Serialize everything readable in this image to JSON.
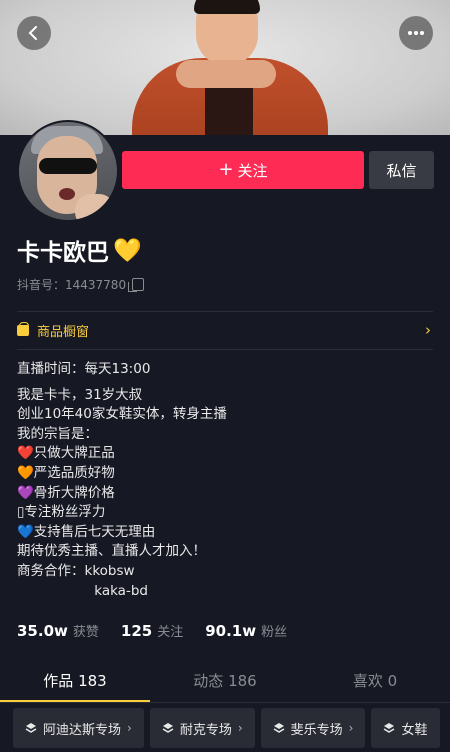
{
  "header": {
    "back_icon": "chevron-left-icon",
    "more_icon": "more-dots-icon"
  },
  "profile": {
    "follow_label": "关注",
    "message_label": "私信",
    "nickname": "卡卡欧巴",
    "nickname_emoji": "💛",
    "douyin_id": "抖音号：14437780"
  },
  "shop": {
    "label": "商品橱窗",
    "arrow": "›"
  },
  "bio": {
    "lines": [
      "直播时间：每天13:00",
      "",
      "我是卡卡，31岁大叔",
      "创业10年40家女鞋实体，转身主播",
      "我的宗旨是：",
      "❤️只做大牌正品",
      "🧡严选品质好物",
      "💜骨折大牌价格",
      "▯专注粉丝浮力",
      "💙支持售后七天无理由",
      "期待优秀主播、直播人才加入！",
      "商务合作：kkobsw",
      "                  kaka-bd"
    ]
  },
  "stats": [
    {
      "value": "35.0w",
      "label": "获赞"
    },
    {
      "value": "125",
      "label": "关注"
    },
    {
      "value": "90.1w",
      "label": "粉丝"
    }
  ],
  "tabs": [
    {
      "label": "作品 183",
      "active": true
    },
    {
      "label": "动态 186",
      "active": false
    },
    {
      "label": "喜欢 0",
      "active": false
    }
  ],
  "categories": [
    {
      "label": "阿迪达斯专场"
    },
    {
      "label": "耐克专场"
    },
    {
      "label": "斐乐专场"
    },
    {
      "label": "女鞋"
    }
  ],
  "colors": {
    "background": "#161823",
    "accent": "#fe2c55",
    "gold": "#facd3d"
  }
}
